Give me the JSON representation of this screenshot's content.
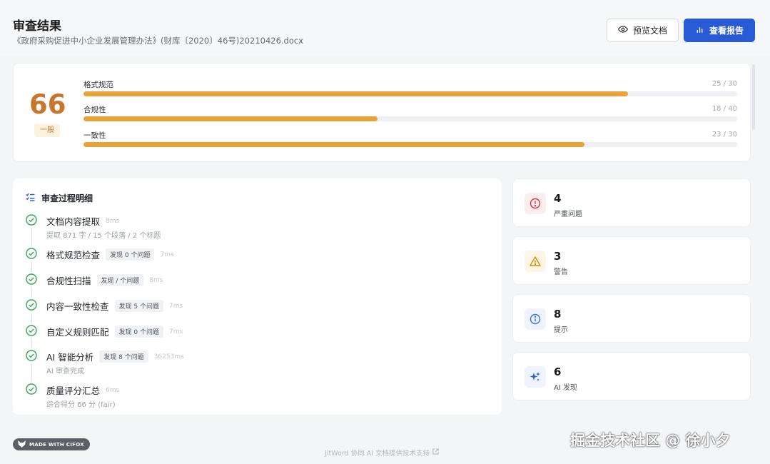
{
  "header": {
    "title": "审查结果",
    "subtitle": "《政府采购促进中小企业发展管理办法》(财库〔2020〕46号)20210426.docx",
    "preview_label": "预览文档",
    "report_label": "查看报告"
  },
  "score": {
    "value": "66",
    "grade": "一般",
    "metrics": [
      {
        "label": "格式规范",
        "value_text": "25 / 30",
        "fraction": 0.8333
      },
      {
        "label": "合规性",
        "value_text": "18 / 40",
        "fraction": 0.45
      },
      {
        "label": "一致性",
        "value_text": "23 / 30",
        "fraction": 0.7667
      }
    ]
  },
  "process": {
    "title": "审查过程明细",
    "steps": [
      {
        "name": "文档内容提取",
        "badge": "",
        "time": "8ms",
        "detail": "提取 871 字 / 15 个段落 / 2 个标题"
      },
      {
        "name": "格式规范检查",
        "badge": "发现 0 个问题",
        "time": "7ms",
        "detail": ""
      },
      {
        "name": "合规性扫描",
        "badge": "发现 / 个问题",
        "time": "8ms",
        "detail": ""
      },
      {
        "name": "内容一致性检查",
        "badge": "发现 5 个问题",
        "time": "7ms",
        "detail": ""
      },
      {
        "name": "自定义规则匹配",
        "badge": "发现 0 个问题",
        "time": "7ms",
        "detail": ""
      },
      {
        "name": "AI 智能分析",
        "badge": "发现 8 个问题",
        "time": "36253ms",
        "detail": "AI 审查完成"
      },
      {
        "name": "质量评分汇总",
        "badge": "",
        "time": "6ms",
        "detail": "综合得分 66 分 (fair)"
      }
    ]
  },
  "stats": [
    {
      "count": "4",
      "label": "严重问题",
      "icon": "alert-circle-icon",
      "color": "#d9363e",
      "bg": "#fdeeee"
    },
    {
      "count": "3",
      "label": "警告",
      "icon": "warning-triangle-icon",
      "color": "#d98e04",
      "bg": "#fdf6e6"
    },
    {
      "count": "8",
      "label": "提示",
      "icon": "info-circle-icon",
      "color": "#3370ff",
      "bg": "#eef3ff"
    },
    {
      "count": "6",
      "label": "AI 发现",
      "icon": "sparkle-icon",
      "color": "#2a5bd7",
      "bg": "#eef3ff"
    }
  ],
  "footer": {
    "made_with": "MADE WITH CIFOX",
    "note": "JitWord 协同 AI 文档提供技术支持"
  },
  "watermark": "掘金技术社区 @ 徐小夕",
  "colors": {
    "accent": "#2a5bd7",
    "score": "#c9762b",
    "bar": "#e8a338",
    "success": "#34a853"
  }
}
